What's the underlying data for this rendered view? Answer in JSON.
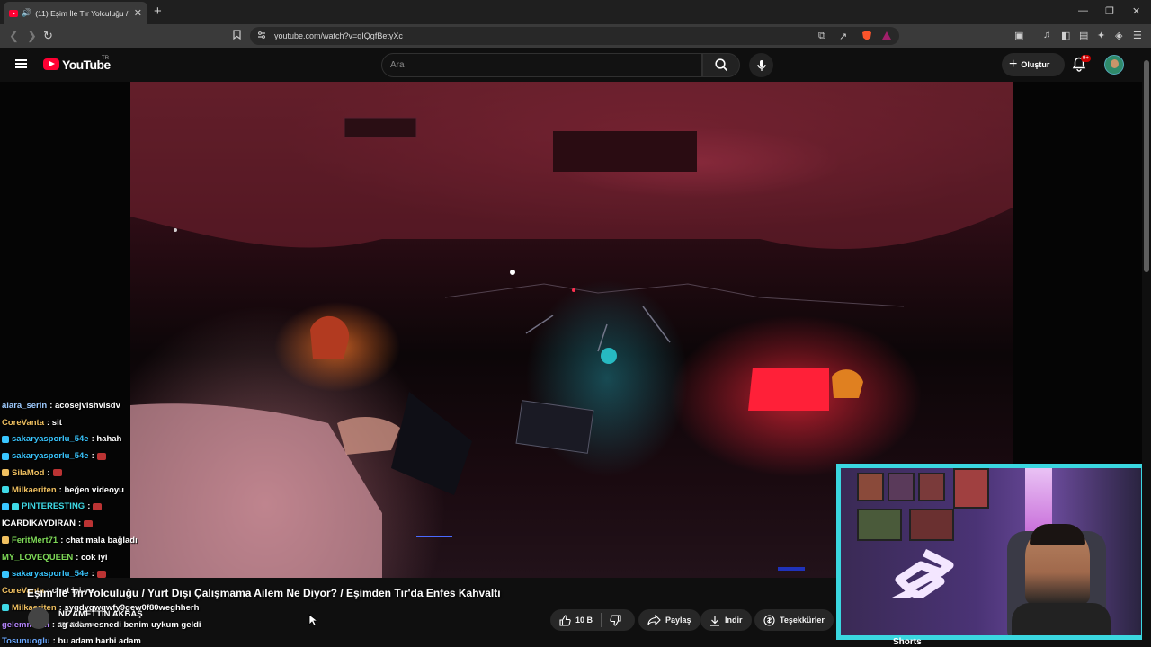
{
  "browser": {
    "tab_title": "(11) Eşim İle Tır Yolculuğu / Yu",
    "url": "youtube.com/watch?v=qIQgfBetyXc"
  },
  "youtube": {
    "logo_text": "YouTube",
    "country_code": "TR",
    "search_placeholder": "Ara",
    "create_label": "Oluştur",
    "notification_count": "9+"
  },
  "chat": [
    {
      "user": "alara_serin",
      "text": ": acosejvishvisdv",
      "color": "#9ecbff",
      "badges": []
    },
    {
      "user": "CoreVanta",
      "text": ": sit",
      "color": "#f0c060",
      "badges": []
    },
    {
      "user": "sakaryasporlu_54e",
      "text": ": hahah",
      "color": "#39c6ff",
      "badges": [
        "blue"
      ]
    },
    {
      "user": "sakaryasporlu_54e",
      "text": ":",
      "color": "#39c6ff",
      "badges": [
        "blue"
      ],
      "emote": true
    },
    {
      "user": "SilaMod",
      "text": ":",
      "color": "#f0c060",
      "badges": [
        "gold"
      ],
      "emote": true
    },
    {
      "user": "Milkaeriten",
      "text": ": beğen videoyu",
      "color": "#f0c060",
      "badges": [
        "teal"
      ]
    },
    {
      "user": "PINTERESTING",
      "text": ":",
      "color": "#3fd9e6",
      "badges": [
        "blue",
        "teal"
      ],
      "emote": true
    },
    {
      "user": "ICARDIKAYDIRAN",
      "text": ":",
      "color": "#ffffff",
      "badges": [],
      "emote": true
    },
    {
      "user": "FeritMert71",
      "text": ": chat mala bağladı",
      "color": "#7ed957",
      "badges": [
        "gold"
      ]
    },
    {
      "user": "MY_LOVEQUEEN",
      "text": ": cok iyi",
      "color": "#7ed957",
      "badges": []
    },
    {
      "user": "sakaryasporlu_54e",
      "text": ":",
      "color": "#39c6ff",
      "badges": [
        "blue"
      ],
      "emote": true
    },
    {
      "user": "CoreVanta",
      "text": ": chat iyi ya",
      "color": "#f0c060",
      "badges": []
    },
    {
      "user": "Milkaeriten",
      "text": ": sygdyqwgwfy9gew0f80weghherh",
      "color": "#f0c060",
      "badges": [
        "teal"
      ]
    },
    {
      "user": "gelemmmm",
      "text": ": ag adam esnedi benim uykum geldi",
      "color": "#b685ff",
      "badges": []
    },
    {
      "user": "Tosunuoglu",
      "text": ": bu adam harbi adam",
      "color": "#6aa8ff",
      "badges": []
    }
  ],
  "video": {
    "title": "Eşim İle Tır Yolculuğu / Yurt Dışı Çalışmama Ailem Ne Diyor? / Eşimden Tır'da Enfes Kahvaltı",
    "channel_name": "NİZAMETTİN AKBAŞ",
    "subscribers": "297 B abone",
    "like_count": "10 B",
    "share_label": "Paylaş",
    "download_label": "İndir",
    "thanks_label": "Teşekkürler"
  },
  "sidebar": {
    "shorts_label": "Shorts"
  },
  "colors": {
    "webcam_border": "#3ad7e0",
    "youtube_red": "#ff0033"
  }
}
